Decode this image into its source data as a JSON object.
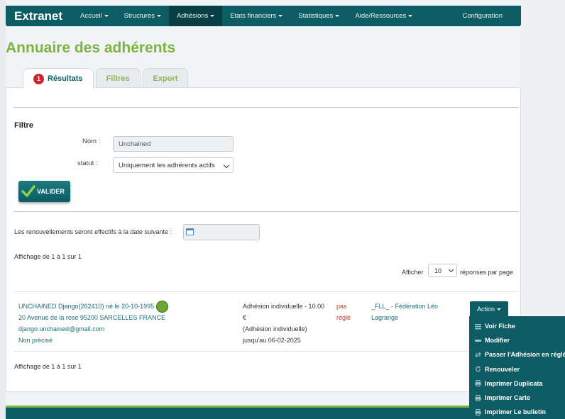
{
  "navbar": {
    "brand": "Extranet",
    "items": [
      {
        "label": "Accueil"
      },
      {
        "label": "Structures"
      },
      {
        "label": "Adhésions"
      },
      {
        "label": "Etats financiers"
      },
      {
        "label": "Statistiques"
      },
      {
        "label": "Aide/Ressources"
      }
    ],
    "config": "Configuration"
  },
  "page_title": "Annuaire des adhérents",
  "tabs": [
    {
      "label": "Résultats",
      "badge": "1"
    },
    {
      "label": "Filtres"
    },
    {
      "label": "Export"
    }
  ],
  "filter": {
    "title": "Filtre",
    "nom_label": "Nom :",
    "nom_value": "Unchained",
    "statut_label": "statut :",
    "statut_value": "Uniquement les adhérents actifs",
    "submit_label": "VALIDER"
  },
  "renewal": {
    "label": "Les renouvellements seront effectifs à la date suivante :",
    "date_value": ""
  },
  "pagination": {
    "summary_top": "Affichage de 1 à 1 sur 1",
    "summary_bottom": "Affichage de 1 à 1 sur 1",
    "show_label": "Afficher",
    "per_page": "10",
    "per_page_suffix": "réponses par page"
  },
  "result_row": {
    "name": "UNCHAINED Django(262410) né le 20-10-1995",
    "address": "20 Avenue de la rose 95200 SARCELLES FRANCE",
    "email": "django.unchained@gmail.com",
    "extra": "Non précisé",
    "adhesion_line1": "Adhésion individuelle - 10.00",
    "adhesion_line2": "€",
    "adhesion_line3": "(Adhésion individuelle)",
    "adhesion_line4": "jusqu'au 06-02-2025",
    "payment_line1": "pas",
    "payment_line2": "réglé",
    "federation_line1": "_FLL_ - Fédération Léo",
    "federation_line2": "Lagrange",
    "action_label": "Action"
  },
  "action_menu": [
    {
      "label": "Voir Fiche",
      "icon": "list-icon"
    },
    {
      "label": "Modifier",
      "icon": "edit-icon"
    },
    {
      "label": "Passer l'Adhésion en réglée",
      "icon": "exchange-icon"
    },
    {
      "label": "Renouveler",
      "icon": "refresh-icon"
    },
    {
      "label": "Imprimer Duplicata",
      "icon": "print-icon"
    },
    {
      "label": "Imprimer Carte",
      "icon": "print-icon"
    },
    {
      "label": "Imprimer Le bulletin",
      "icon": "print-icon"
    }
  ],
  "colors": {
    "primary": "#0d5c63",
    "accent_green": "#7cb442",
    "badge_red": "#d1232a"
  }
}
